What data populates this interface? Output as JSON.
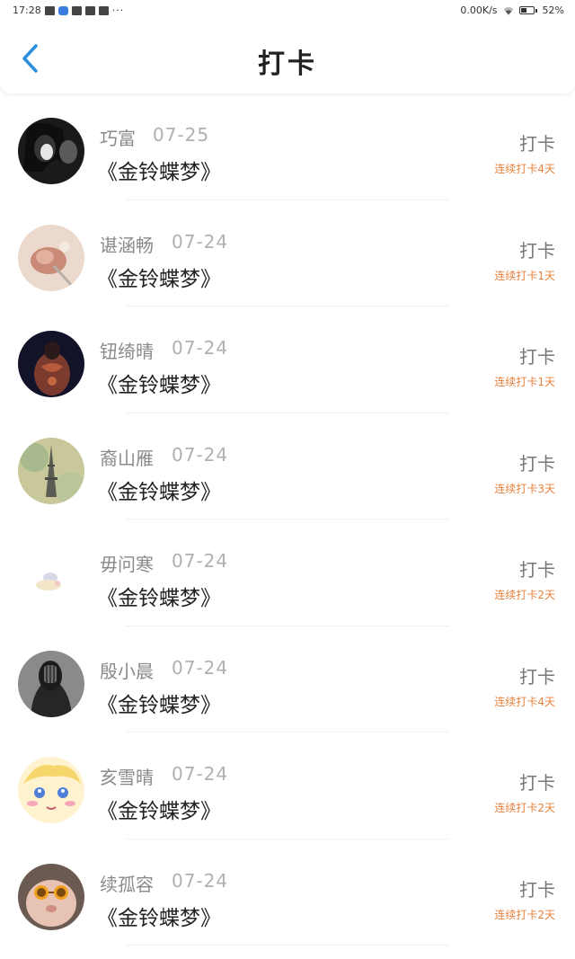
{
  "status_bar": {
    "time": "17:28",
    "more": "···",
    "speed": "0.00K/s",
    "battery": "52%"
  },
  "header": {
    "title": "打卡",
    "back_icon": "chevron-left-icon",
    "accent_color": "#2b8fe0"
  },
  "streak_color": "#e8813c",
  "entries": [
    {
      "name": "巧富",
      "date": "07-25",
      "book": "《金铃蝶梦》",
      "action": "打卡",
      "streak": "连续打卡4天"
    },
    {
      "name": "谌涵畅",
      "date": "07-24",
      "book": "《金铃蝶梦》",
      "action": "打卡",
      "streak": "连续打卡1天"
    },
    {
      "name": "钮绮晴",
      "date": "07-24",
      "book": "《金铃蝶梦》",
      "action": "打卡",
      "streak": "连续打卡1天"
    },
    {
      "name": "裔山雁",
      "date": "07-24",
      "book": "《金铃蝶梦》",
      "action": "打卡",
      "streak": "连续打卡3天"
    },
    {
      "name": "毋问寒",
      "date": "07-24",
      "book": "《金铃蝶梦》",
      "action": "打卡",
      "streak": "连续打卡2天"
    },
    {
      "name": "殷小晨",
      "date": "07-24",
      "book": "《金铃蝶梦》",
      "action": "打卡",
      "streak": "连续打卡4天"
    },
    {
      "name": "亥雪晴",
      "date": "07-24",
      "book": "《金铃蝶梦》",
      "action": "打卡",
      "streak": "连续打卡2天"
    },
    {
      "name": "续孤容",
      "date": "07-24",
      "book": "《金铃蝶梦》",
      "action": "打卡",
      "streak": "连续打卡2天"
    }
  ]
}
